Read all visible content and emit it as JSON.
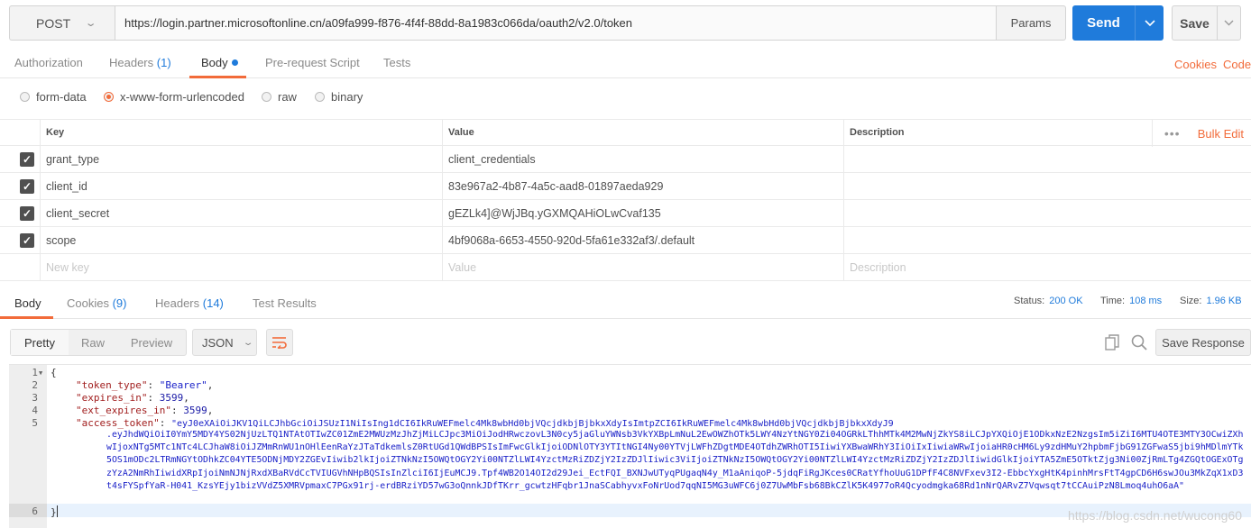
{
  "request": {
    "method": "POST",
    "url": "https://login.partner.microsoftonline.cn/a09fa999-f876-4f4f-88dd-8a1983c066da/oauth2/v2.0/token",
    "params_label": "Params",
    "send_label": "Send",
    "save_label": "Save"
  },
  "req_tabs": {
    "authorization": "Authorization",
    "headers": "Headers",
    "headers_count": "(1)",
    "body": "Body",
    "prerequest": "Pre-request Script",
    "tests": "Tests",
    "cookies": "Cookies",
    "code": "Code"
  },
  "body_types": {
    "form_data": "form-data",
    "urlencoded": "x-www-form-urlencoded",
    "raw": "raw",
    "binary": "binary",
    "selected": "x-www-form-urlencoded"
  },
  "kv_table": {
    "headers": {
      "key": "Key",
      "value": "Value",
      "description": "Description",
      "bulk_edit": "Bulk Edit",
      "more": "•••"
    },
    "rows": [
      {
        "key": "grant_type",
        "value": "client_credentials",
        "description": ""
      },
      {
        "key": "client_id",
        "value": "83e967a2-4b87-4a5c-aad8-01897aeda929",
        "description": ""
      },
      {
        "key": "client_secret",
        "value": "gEZLk4]@WjJBq.yGXMQAHiOLwCvaf135",
        "description": ""
      },
      {
        "key": "scope",
        "value": "4bf9068a-6653-4550-920d-5fa61e332af3/.default",
        "description": ""
      }
    ],
    "new_row": {
      "key": "New key",
      "value": "Value",
      "description": "Description"
    }
  },
  "resp_tabs": {
    "body": "Body",
    "cookies": "Cookies",
    "cookies_count": "(9)",
    "headers": "Headers",
    "headers_count": "(14)",
    "test_results": "Test Results"
  },
  "status": {
    "status_label": "Status:",
    "status_value": "200 OK",
    "time_label": "Time:",
    "time_value": "108 ms",
    "size_label": "Size:",
    "size_value": "1.96 KB"
  },
  "resp_tools": {
    "pretty": "Pretty",
    "raw": "Raw",
    "preview": "Preview",
    "format": "JSON",
    "save_response": "Save Response"
  },
  "code": {
    "line_numbers": [
      "1",
      "2",
      "3",
      "4",
      "5",
      "6"
    ],
    "open_brace": "{",
    "close_brace": "}",
    "token_type_key": "\"token_type\"",
    "token_type_val": "\"Bearer\"",
    "expires_in_key": "\"expires_in\"",
    "expires_in_val": "3599",
    "ext_expires_in_key": "\"ext_expires_in\"",
    "ext_expires_in_val": "3599",
    "access_token_key": "\"access_token\"",
    "access_token_first": "\"eyJ0eXAiOiJKV1QiLCJhbGciOiJSUzI1NiIsIng1dCI6IkRuWEFmelc4Mk8wbHd0bjVQcjdkbjBjbkxXdyIsImtpZCI6IkRuWEFmelc4Mk8wbHd0bjVQcjdkbjBjbkxXdyJ9",
    "access_token_rest": ".eyJhdWQiOiI0YmY5MDY4YS02NjUzLTQ1NTAtOTIwZC01ZmE2MWUzMzJhZjMiLCJpc3MiOiJodHRwczovL3N0cy5jaGluYWNsb3VkYXBpLmNuL2EwOWZhOTk5LWY4NzYtNGY0Zi04OGRkLThhMTk4M2MwNjZkYS8iLCJpYXQiOjE1ODkxNzE2NzgsIm5iZiI6MTU4OTE3MTY3OCwiZXhwIjoxNTg5MTc1NTc4LCJhaW8iOiJZMmRnWU1nOHlEenRaYzJTaTdkemlsZ0RtUGd1QWdBPSIsImFwcGlkIjoiODNlOTY3YTItNGI4Ny00YTVjLWFhZDgtMDE4OTdhZWRhOTI5IiwiYXBwaWRhY3IiOiIxIiwiaWRwIjoiaHR0cHM6Ly9zdHMuY2hpbmFjbG91ZGFwaS5jbi9hMDlmYTk5OS1mODc2LTRmNGYtODhkZC04YTE5ODNjMDY2ZGEvIiwib2lkIjoiZTNkNzI5OWQtOGY2Yi00NTZlLWI4YzctMzRiZDZjY2IzZDJlIiwic3ViIjoiZTNkNzI5OWQtOGY2Yi00NTZlLWI4YzctMzRiZDZjY2IzZDJlIiwidGlkIjoiYTA5ZmE5OTktZjg3Ni00ZjRmLTg4ZGQtOGExOTgzYzA2NmRhIiwidXRpIjoiNmNJNjRxdXBaRVdCcTVIUGVhNHpBQSIsInZlciI6IjEuMCJ9.Tpf4WB2O14OI2d29Jei_EctFQI_BXNJwUTyqPUgaqN4y_M1aAniqoP-5jdqFiRgJKces0CRatYfhoUuG1DPfF4C8NVFxev3I2-EbbcYxgHtK4pinhMrsFtT4gpCD6H6swJOu3MkZqX1xD3t4sFYSpfYaR-H041_KzsYEjy1bizVVdZ5XMRVpmaxC7PGx91rj-erdBRziYD57wG3oQnnkJDfTKrr_gcwtzHFqbr1JnaSCabhyvxFoNrUod7qqNI5MG3uWFC6j0Z7UwMbFsb68BkCZlK5K4977oR4Qcyodmgka68Rd1nNrQARvZ7Vqwsqt7tCCAuiPzN8Lmoq4uhO6aA\""
  },
  "watermark": "https://blog.csdn.net/wucong60",
  "colors": {
    "accent": "#f26b3a",
    "primary": "#1f7bdb"
  }
}
